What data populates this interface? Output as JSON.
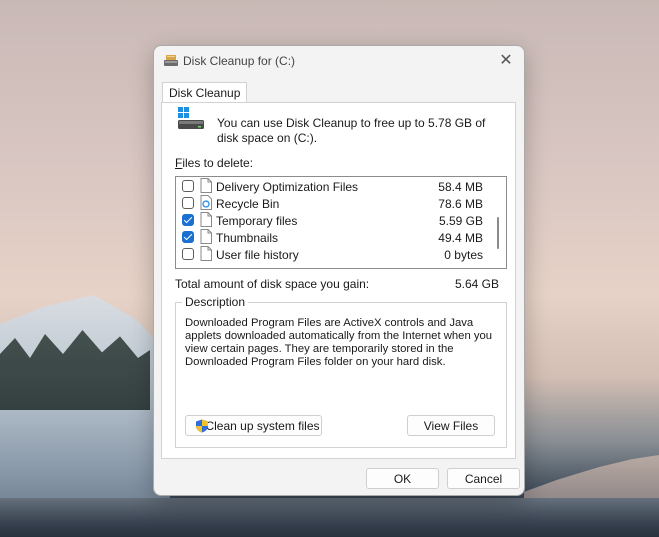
{
  "window": {
    "title": "Disk Cleanup for  (C:)",
    "close_glyph": "✕"
  },
  "tab": {
    "label": "Disk Cleanup"
  },
  "intro_text": "You can use Disk Cleanup to free up to 5.78 GB of disk space on  (C:).",
  "files_label": "Files to delete:",
  "files": [
    {
      "name": "Delivery Optimization Files",
      "size": "58.4 MB",
      "checked": false,
      "icon": "file-icon"
    },
    {
      "name": "Recycle Bin",
      "size": "78.6 MB",
      "checked": false,
      "icon": "recycle-bin-icon"
    },
    {
      "name": "Temporary files",
      "size": "5.59 GB",
      "checked": true,
      "icon": "file-icon"
    },
    {
      "name": "Thumbnails",
      "size": "49.4 MB",
      "checked": true,
      "icon": "file-icon"
    },
    {
      "name": "User file history",
      "size": "0 bytes",
      "checked": false,
      "icon": "file-icon"
    }
  ],
  "total": {
    "label": "Total amount of disk space you gain:",
    "value": "5.64 GB"
  },
  "description": {
    "title": "Description",
    "text": "Downloaded Program Files are ActiveX controls and Java applets downloaded automatically from the Internet when you view certain pages. They are temporarily stored in the Downloaded Program Files folder on your hard disk."
  },
  "buttons": {
    "clean_system": "Clean up system files",
    "view_files": "View Files",
    "ok": "OK",
    "cancel": "Cancel"
  },
  "colors": {
    "checkbox_accent": "#1a6fd1",
    "shield_blue": "#2f6fd6",
    "shield_yellow": "#f2c12e"
  }
}
